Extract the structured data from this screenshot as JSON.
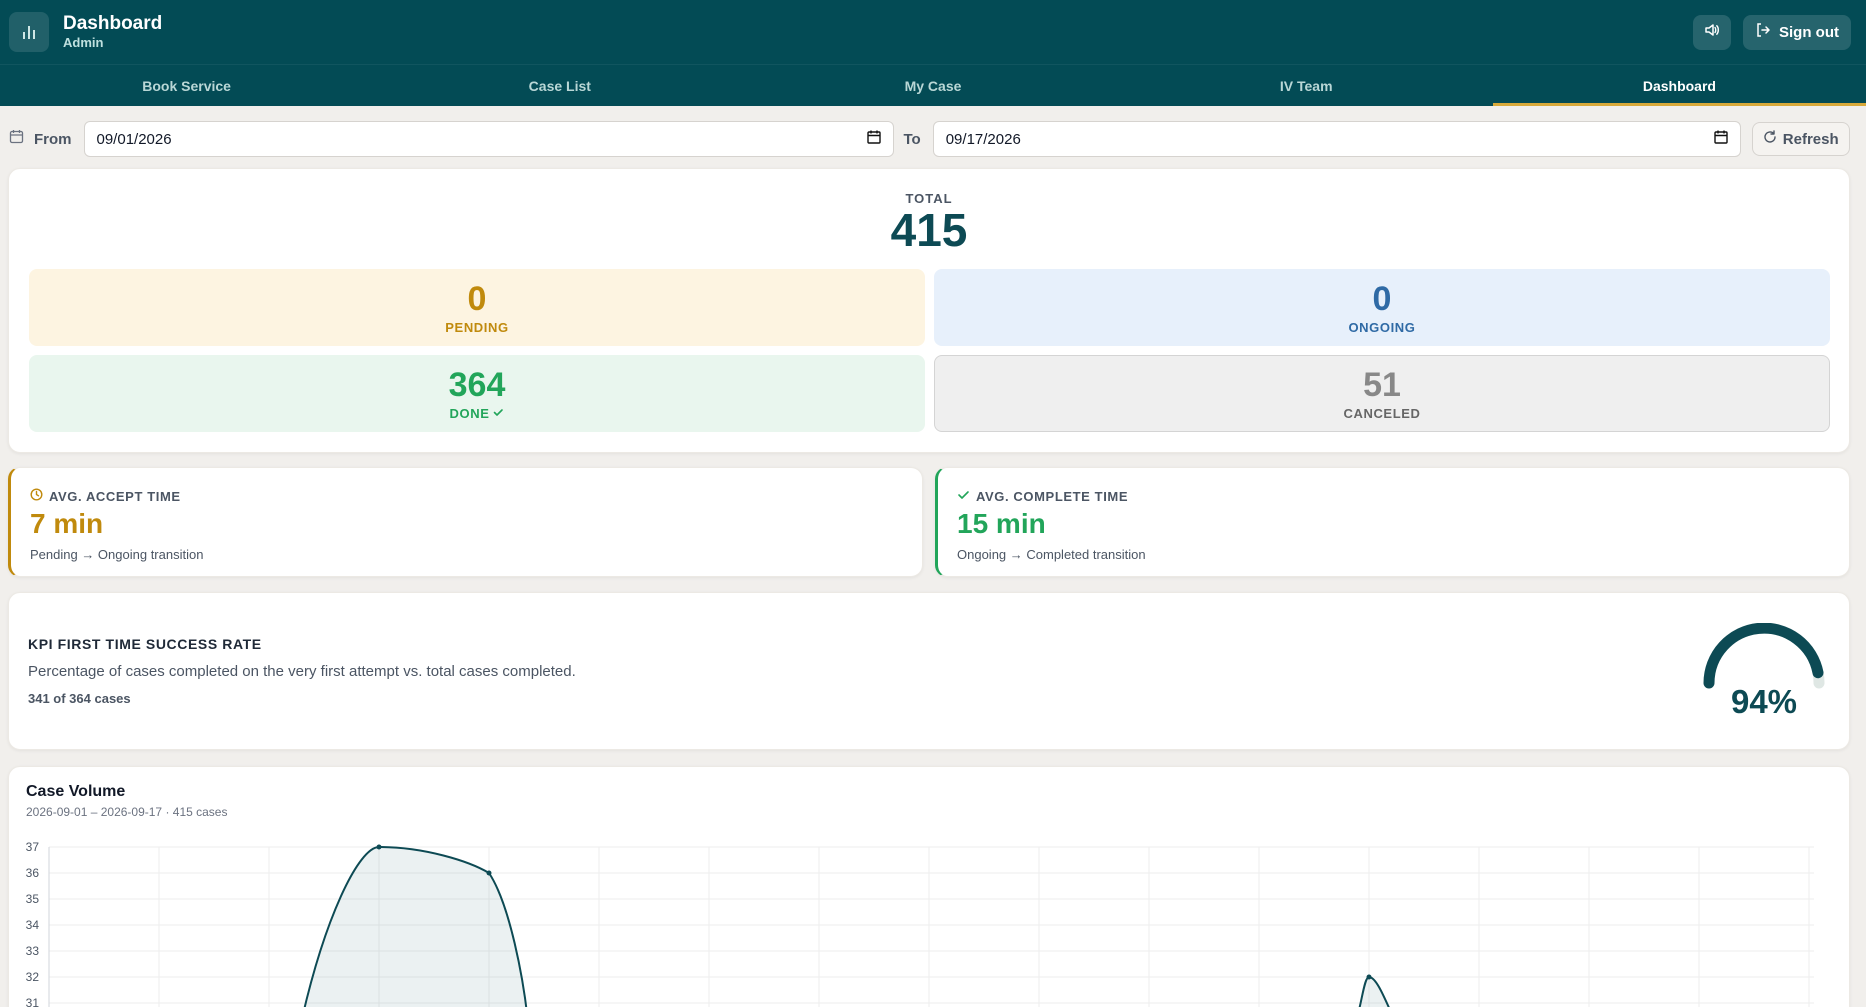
{
  "header": {
    "title": "Dashboard",
    "subtitle": "Admin",
    "signout_label": "Sign out"
  },
  "nav": {
    "tabs": [
      {
        "label": "Book Service",
        "active": false
      },
      {
        "label": "Case List",
        "active": false
      },
      {
        "label": "My Case",
        "active": false
      },
      {
        "label": "IV Team",
        "active": false
      },
      {
        "label": "Dashboard",
        "active": true
      }
    ]
  },
  "filters": {
    "from_label": "From",
    "from_value": "09/01/2026",
    "to_label": "To",
    "to_value": "09/17/2026",
    "refresh_label": "Refresh"
  },
  "summary": {
    "total_label": "TOTAL",
    "total_value": "415",
    "pending": {
      "value": "0",
      "label": "PENDING"
    },
    "ongoing": {
      "value": "0",
      "label": "ONGOING"
    },
    "done": {
      "value": "364",
      "label": "DONE"
    },
    "canceled": {
      "value": "51",
      "label": "CANCELED"
    }
  },
  "metrics": {
    "accept": {
      "label": "AVG. ACCEPT TIME",
      "value": "7 min",
      "sub": "Pending → Ongoing transition"
    },
    "complete": {
      "label": "AVG. COMPLETE TIME",
      "value": "15 min",
      "sub": "Ongoing → Completed transition"
    }
  },
  "kpi": {
    "title": "KPI FIRST TIME SUCCESS RATE",
    "description": "Percentage of cases completed on the very first attempt vs. total cases completed.",
    "count": "341 of 364 cases",
    "value": "94%",
    "fraction": 0.94
  },
  "colors": {
    "brand": "#034b55",
    "accent": "#d8a93a",
    "pending": "#c08a0d",
    "ongoing": "#2f6aa5",
    "done": "#22a55a",
    "canceled": "#888888"
  },
  "chart": {
    "title": "Case Volume",
    "subtitle": "2026-09-01 – 2026-09-17 · 415 cases"
  },
  "chart_data": {
    "type": "area",
    "y_ticks": [
      "37",
      "36",
      "35",
      "34",
      "33",
      "32",
      "31"
    ],
    "ylim": [
      31,
      37
    ],
    "series": [
      {
        "points": [
          {
            "x": 3,
            "y": 37
          },
          {
            "x": 4,
            "y": 36
          },
          {
            "x": 12,
            "y": 32
          }
        ]
      }
    ]
  }
}
